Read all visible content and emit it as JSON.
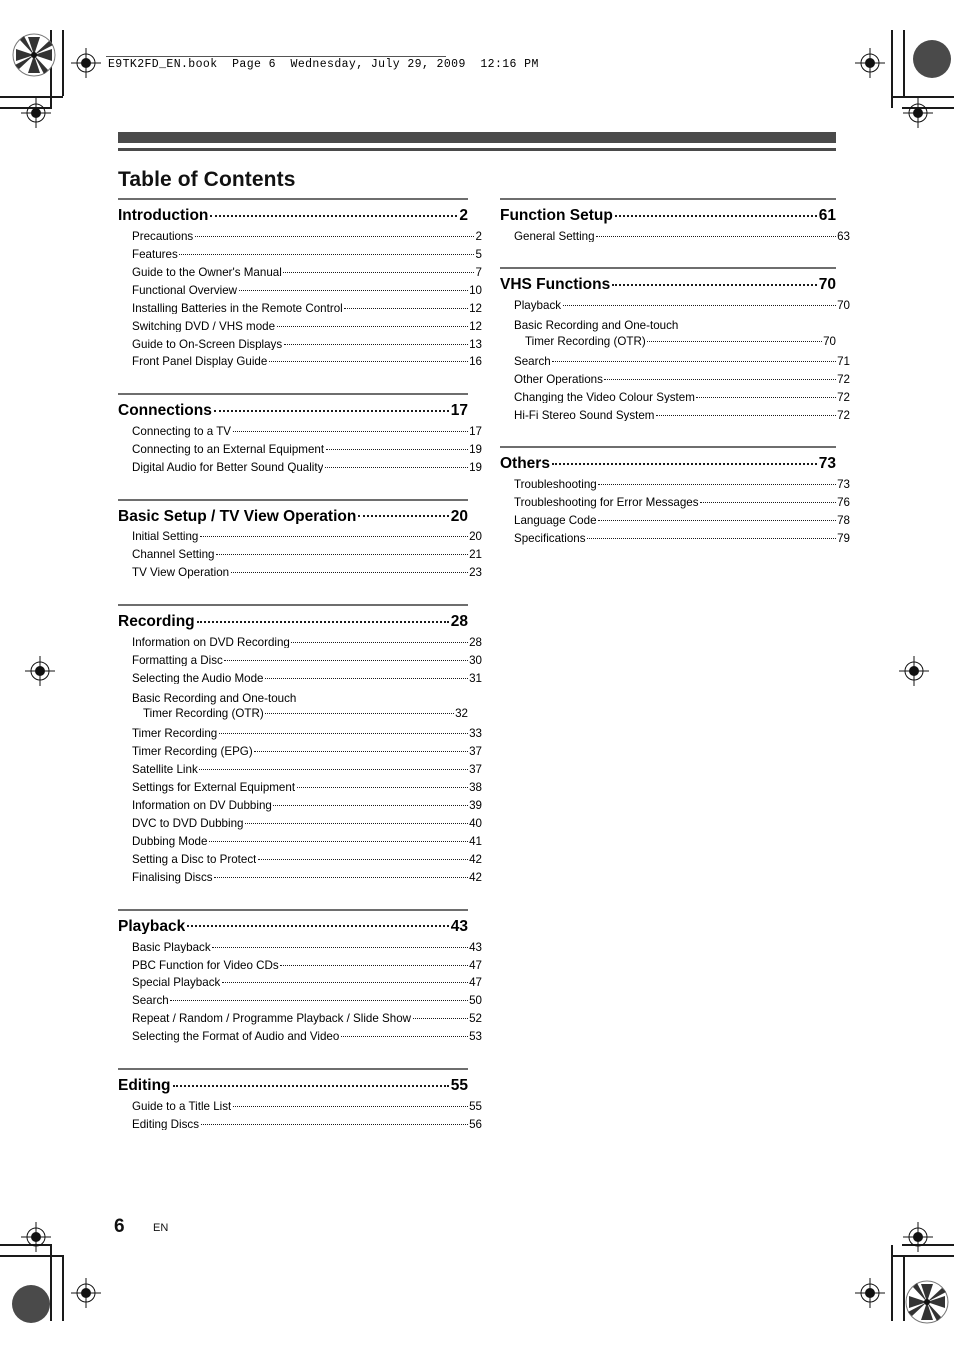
{
  "running_head": "E9TK2FD_EN.book  Page 6  Wednesday, July 29, 2009  12:16 PM",
  "header": {
    "title": "Table of Contents"
  },
  "footer": {
    "page_number": "6",
    "language_code": "EN"
  },
  "columns": {
    "left": [
      {
        "heading": {
          "label": "Introduction",
          "page": "2"
        },
        "entries": [
          {
            "label": "Precautions",
            "page": "2"
          },
          {
            "label": "Features",
            "page": "5"
          },
          {
            "label": "Guide to the Owner's Manual",
            "page": "7"
          },
          {
            "label": "Functional Overview",
            "page": "10"
          },
          {
            "label": "Installing Batteries in the Remote Control",
            "page": "12"
          },
          {
            "label": "Switching DVD / VHS mode",
            "page": "12"
          },
          {
            "label": "Guide to On-Screen Displays",
            "page": "13"
          },
          {
            "label": "Front Panel Display Guide",
            "page": "16"
          }
        ]
      },
      {
        "heading": {
          "label": "Connections",
          "page": "17"
        },
        "entries": [
          {
            "label": "Connecting to a TV",
            "page": "17"
          },
          {
            "label": "Connecting to an External Equipment",
            "page": "19"
          },
          {
            "label": "Digital Audio for Better Sound Quality",
            "page": "19"
          }
        ]
      },
      {
        "heading": {
          "label": "Basic Setup / TV View Operation",
          "page": "20"
        },
        "entries": [
          {
            "label": "Initial Setting",
            "page": "20"
          },
          {
            "label": "Channel Setting",
            "page": "21"
          },
          {
            "label": "TV View Operation",
            "page": "23"
          }
        ]
      },
      {
        "heading": {
          "label": "Recording",
          "page": "28"
        },
        "entries": [
          {
            "label": "Information on DVD Recording",
            "page": "28"
          },
          {
            "label": "Formatting a Disc",
            "page": "30"
          },
          {
            "label": "Selecting the Audio Mode",
            "page": "31"
          },
          {
            "line1": "Basic Recording and One-touch",
            "label": "Timer Recording (OTR)",
            "page": "32"
          },
          {
            "label": "Timer Recording",
            "page": "33"
          },
          {
            "label": "Timer Recording (EPG)",
            "page": "37"
          },
          {
            "label": "Satellite Link",
            "page": "37"
          },
          {
            "label": "Settings for External Equipment",
            "page": "38"
          },
          {
            "label": "Information on DV Dubbing",
            "page": "39"
          },
          {
            "label": "DVC to DVD Dubbing",
            "page": "40"
          },
          {
            "label": "Dubbing Mode",
            "page": "41"
          },
          {
            "label": "Setting a Disc to Protect",
            "page": "42"
          },
          {
            "label": "Finalising Discs",
            "page": "42"
          }
        ]
      },
      {
        "heading": {
          "label": "Playback",
          "page": "43"
        },
        "entries": [
          {
            "label": "Basic Playback",
            "page": "43"
          },
          {
            "label": "PBC Function for Video CDs",
            "page": "47"
          },
          {
            "label": "Special Playback",
            "page": "47"
          },
          {
            "label": "Search",
            "page": "50"
          },
          {
            "label": "Repeat / Random / Programme Playback / Slide Show",
            "page": "52"
          },
          {
            "label": "Selecting the Format of Audio and Video",
            "page": "53"
          }
        ]
      },
      {
        "heading": {
          "label": "Editing",
          "page": "55"
        },
        "entries": [
          {
            "label": "Guide to a Title List",
            "page": "55"
          },
          {
            "label": "Editing Discs",
            "page": "56"
          }
        ]
      }
    ],
    "right": [
      {
        "heading": {
          "label": "Function Setup",
          "page": "61"
        },
        "entries": [
          {
            "label": "General Setting",
            "page": "63"
          }
        ]
      },
      {
        "heading": {
          "label": "VHS Functions",
          "page": "70"
        },
        "entries": [
          {
            "label": "Playback",
            "page": "70"
          },
          {
            "line1": "Basic Recording and One-touch",
            "label": "Timer Recording (OTR)",
            "page": "70"
          },
          {
            "label": "Search",
            "page": "71"
          },
          {
            "label": "Other Operations",
            "page": "72"
          },
          {
            "label": "Changing the Video Colour System",
            "page": "72"
          },
          {
            "label": "Hi-Fi Stereo Sound System",
            "page": "72"
          }
        ]
      },
      {
        "heading": {
          "label": "Others",
          "page": "73"
        },
        "entries": [
          {
            "label": "Troubleshooting",
            "page": "73"
          },
          {
            "label": "Troubleshooting for Error Messages",
            "page": "76"
          },
          {
            "label": "Language Code",
            "page": "78"
          },
          {
            "label": "Specifications",
            "page": "79"
          }
        ]
      }
    ]
  }
}
